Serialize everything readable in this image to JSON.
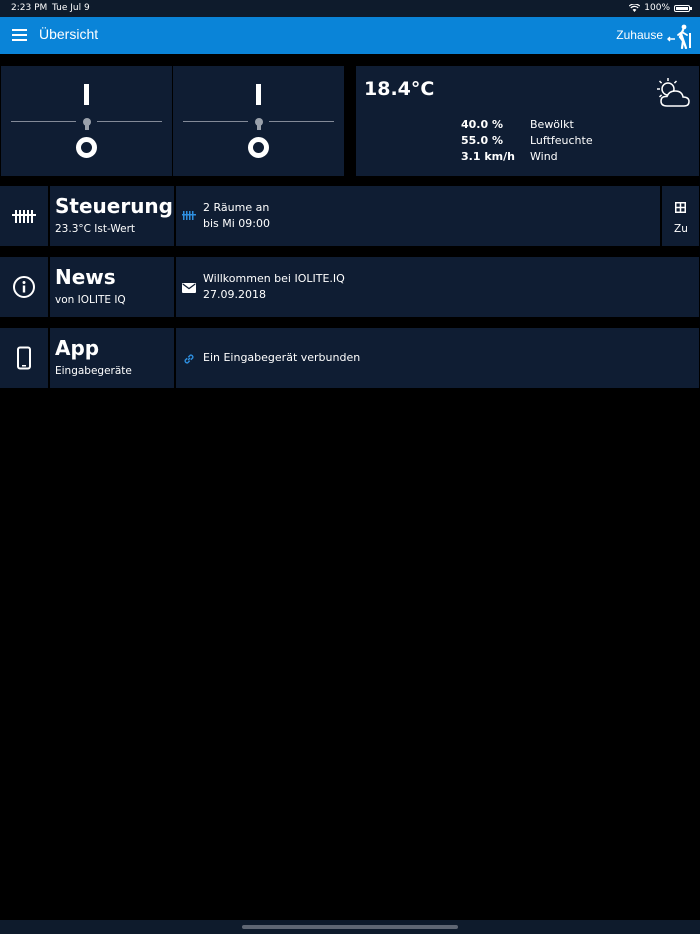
{
  "status": {
    "time": "2:23 PM",
    "date": "Tue Jul 9",
    "battery": "100%"
  },
  "nav": {
    "title": "Übersicht",
    "mode": "Zuhause"
  },
  "switches": [
    {
      "on_symbol": "I",
      "off_symbol": "O"
    },
    {
      "on_symbol": "I",
      "off_symbol": "O"
    }
  ],
  "weather": {
    "temperature": "18.4°C",
    "rows": [
      {
        "value": "40.0 %",
        "label": "Bewölkt"
      },
      {
        "value": "55.0 %",
        "label": "Luftfeuchte"
      },
      {
        "value": "3.1 km/h",
        "label": "Wind"
      }
    ]
  },
  "steuerung": {
    "title": "Steuerung",
    "subtitle": "23.3°C Ist-Wert",
    "line1": "2 Räume an",
    "line2": "bis Mi 09:00",
    "zu_label": "Zu"
  },
  "news": {
    "title": "News",
    "subtitle": "von IOLITE IQ",
    "line1": "Willkommen bei IOLITE.IQ",
    "line2": "27.09.2018"
  },
  "app": {
    "title": "App",
    "subtitle": "Eingabegeräte",
    "line1": "Ein Eingabegerät verbunden"
  },
  "colors": {
    "nav_blue": "#0a84d8",
    "tile_bg": "#0f1d33",
    "accent_blue": "#2e8fe0"
  }
}
